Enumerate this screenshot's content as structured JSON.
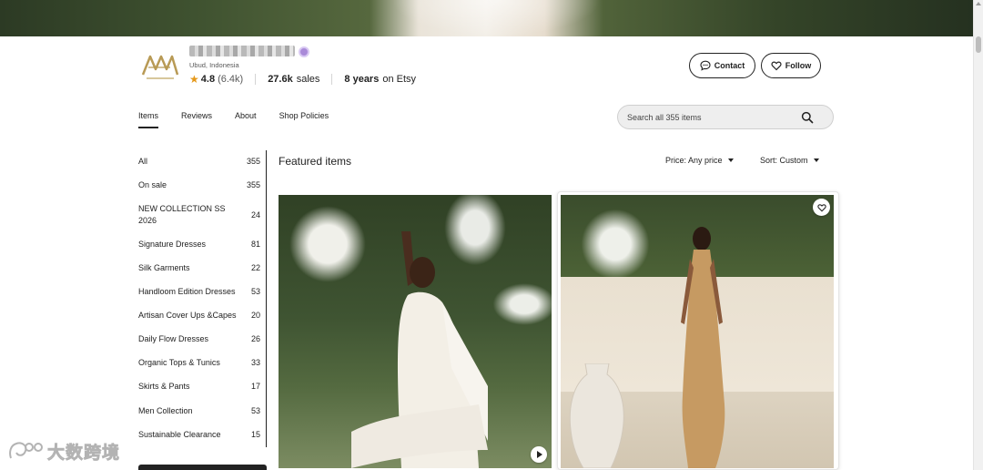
{
  "shop": {
    "location": "Ubud, Indonesia",
    "rating": "4.8",
    "review_count": "(6.4k)",
    "sales_count": "27.6k",
    "sales_label": "sales",
    "years": "8 years",
    "years_suffix": "on Etsy"
  },
  "header_buttons": {
    "contact_label": "Contact",
    "follow_label": "Follow"
  },
  "tabs": [
    {
      "label": "Items",
      "active": true
    },
    {
      "label": "Reviews",
      "active": false
    },
    {
      "label": "About",
      "active": false
    },
    {
      "label": "Shop Policies",
      "active": false
    }
  ],
  "search": {
    "placeholder": "Search all 355 items"
  },
  "sidebar": {
    "categories": [
      {
        "label": "All",
        "count": "355"
      },
      {
        "label": "On sale",
        "count": "355"
      },
      {
        "label": "NEW COLLECTION SS 2026",
        "count": "24"
      },
      {
        "label": "Signature Dresses",
        "count": "81"
      },
      {
        "label": "Silk Garments",
        "count": "22"
      },
      {
        "label": "Handloom Edition Dresses",
        "count": "53"
      },
      {
        "label": "Artisan Cover Ups &Capes",
        "count": "20"
      },
      {
        "label": "Daily Flow Dresses",
        "count": "26"
      },
      {
        "label": "Organic Tops & Tunics",
        "count": "33"
      },
      {
        "label": "Skirts & Pants",
        "count": "17"
      },
      {
        "label": "Men Collection",
        "count": "53"
      },
      {
        "label": "Sustainable Clearance",
        "count": "15"
      }
    ]
  },
  "main": {
    "title": "Featured items",
    "price_filter": "Price: Any price",
    "sort_filter": "Sort: Custom"
  },
  "watermark": {
    "text": "大数跨境"
  },
  "colors": {
    "accent_star": "#e59819",
    "text": "#222222",
    "search_bg": "#eeeeee"
  },
  "icons": [
    "contact-icon",
    "heart-icon",
    "search-icon",
    "play-icon",
    "caret-down-icon",
    "star-icon"
  ]
}
